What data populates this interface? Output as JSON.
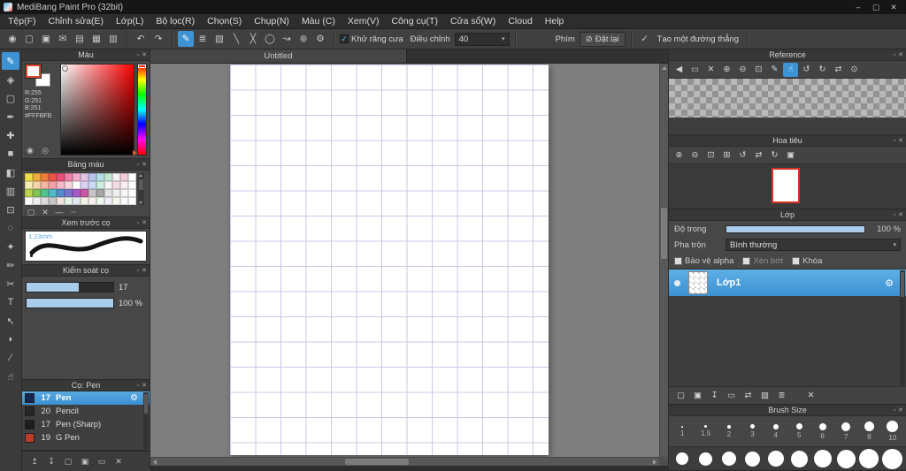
{
  "window": {
    "title": "MediBang Paint Pro (32bit)",
    "minimize": "–",
    "maximize": "▢",
    "close": "✕"
  },
  "ui": {
    "float_icon": "▫",
    "close_icon": "✕",
    "gear_icon": "⚙",
    "dropdown_arrow": "▾"
  },
  "menu": {
    "items": [
      "Tệp(F)",
      "Chỉnh sửa(E)",
      "Lớp(L)",
      "Bộ lọc(R)",
      "Chọn(S)",
      "Chụp(N)",
      "Màu (C)",
      "Xem(V)",
      "Công cụ(T)",
      "Cửa sổ(W)",
      "Cloud",
      "Help"
    ]
  },
  "toolbar": {
    "file_icons": [
      {
        "name": "logo-icon",
        "glyph": "◉"
      },
      {
        "name": "new-canvas-icon",
        "glyph": "▢"
      },
      {
        "name": "save-icon",
        "glyph": "▣"
      },
      {
        "name": "comment-icon",
        "glyph": "✉"
      },
      {
        "name": "export-icon",
        "glyph": "▤"
      },
      {
        "name": "grid-view-icon",
        "glyph": "▦"
      },
      {
        "name": "material-panel-icon",
        "glyph": "▥"
      }
    ],
    "undo_icon": "↶",
    "redo_icon": "↷",
    "brush_modes": [
      {
        "name": "freehand-mode-icon",
        "glyph": "✎",
        "selected": true
      },
      {
        "name": "multi-line-mode-icon",
        "glyph": "≣"
      },
      {
        "name": "hatch-mode-icon",
        "glyph": "▨"
      },
      {
        "name": "line-mode-icon",
        "glyph": "╲"
      },
      {
        "name": "cross-mode-icon",
        "glyph": "╳"
      },
      {
        "name": "ellipse-mode-icon",
        "glyph": "◯"
      },
      {
        "name": "curve-mode-icon",
        "glyph": "↝"
      },
      {
        "name": "scatter-mode-icon",
        "glyph": "⊛"
      },
      {
        "name": "brush-settings-icon",
        "glyph": "⚙"
      }
    ],
    "antialias_label": "Khử răng cưa",
    "correction_label": "Điều chỉnh",
    "correction_value": "40",
    "key_label": "Phím",
    "no_key_icon": "⊘",
    "reset_label": "Đặt lại",
    "check_icon": "✓",
    "straight_line_label": "Tạo một đường thẳng"
  },
  "tools": [
    {
      "name": "brush-tool",
      "glyph": "✎",
      "selected": true
    },
    {
      "name": "eraser-tool",
      "glyph": "◈"
    },
    {
      "name": "shape-tool",
      "glyph": "▢"
    },
    {
      "name": "ink-tool",
      "glyph": "✒"
    },
    {
      "name": "move-tool",
      "glyph": "✚"
    },
    {
      "name": "fill-tool",
      "glyph": "■"
    },
    {
      "name": "bucket-tool",
      "glyph": "◧"
    },
    {
      "name": "gradient-tool",
      "glyph": "▥"
    },
    {
      "name": "select-tool",
      "glyph": "⊡"
    },
    {
      "name": "lasso-tool",
      "glyph": "◌"
    },
    {
      "name": "magic-wand-tool",
      "glyph": "✦"
    },
    {
      "name": "select-pen-tool",
      "glyph": "✏"
    },
    {
      "name": "select-eraser-tool",
      "glyph": "✂"
    },
    {
      "name": "text-tool",
      "glyph": "T"
    },
    {
      "name": "operation-tool",
      "glyph": "↖"
    },
    {
      "name": "eyedropper-tool",
      "glyph": "◗"
    },
    {
      "name": "divide-tool",
      "glyph": "∕"
    },
    {
      "name": "hand-tool",
      "glyph": "☝"
    }
  ],
  "color_panel": {
    "title": "Màu",
    "r": "R:255",
    "g": "G:251",
    "b": "B:251",
    "hex": "#FFFBFB",
    "fg_color": "#FFFBFB",
    "icons": [
      {
        "name": "color-dialog-icon",
        "glyph": "◉"
      },
      {
        "name": "transparent-color-icon",
        "glyph": "◎"
      }
    ]
  },
  "palette_panel": {
    "title": "Bảng màu",
    "rows": [
      [
        "#efe04a",
        "#efab3e",
        "#ee7f3a",
        "#ec5546",
        "#ea4f78",
        "#ef82ac",
        "#f2abc9",
        "#e5c6e2",
        "#b7c3ea",
        "#b7dfea",
        "#c2ead2",
        "#f2f2f2",
        "#f2ccd8",
        "#ffffff"
      ],
      [
        "#f6eeb0",
        "#f6d5a6",
        "#f6b7a2",
        "#f4a2aa",
        "#f6bac9",
        "#f9d3dd",
        "#fefefe",
        "#dcd2f1",
        "#cadbf3",
        "#ccefde",
        "#f6f6f6",
        "#f6dde5",
        "#fbedf1",
        "#ffffff"
      ],
      [
        "#bbd34d",
        "#82c353",
        "#53c38d",
        "#51bbc3",
        "#538fcb",
        "#7973cb",
        "#a75bc7",
        "#cb57a7",
        "#c7c7c7",
        "#a7a7a7",
        "#e3e3e3",
        "#efefef",
        "#f6f6f6",
        "#ffffff"
      ],
      [
        "#ffffff",
        "#eeeeee",
        "#dbdbdb",
        "#c7c7c7",
        "#f3e3e3",
        "#e3f3e7",
        "#e3e7f3",
        "#f3f3e3",
        "#f9efef",
        "#eff9ef",
        "#efeff9",
        "#f9f9ef",
        "#fbfbfb",
        "#ffffff"
      ]
    ],
    "footer_icons": [
      {
        "name": "add-swatch-icon",
        "glyph": "▢"
      },
      {
        "name": "delete-swatch-icon",
        "glyph": "✕"
      },
      {
        "name": "solid-line-icon",
        "glyph": "—"
      },
      {
        "name": "dashed-line-icon",
        "glyph": "┄"
      }
    ]
  },
  "brush_preview_panel": {
    "title": "Xem trước cọ",
    "size_label": "1.23mm"
  },
  "brush_control_panel": {
    "title": "Kiểm soát cọ",
    "size_value": "17",
    "size_fill_pct": 60,
    "opacity_value": "100 %",
    "opacity_fill_pct": 100
  },
  "brush_list_panel": {
    "title": "Cọ: Pen",
    "items": [
      {
        "width": "17",
        "name": "Pen",
        "selected": true,
        "thumb": "#16264e"
      },
      {
        "width": "20",
        "name": "Pencil",
        "selected": false,
        "thumb": "#262626"
      },
      {
        "width": "17",
        "name": "Pen (Sharp)",
        "selected": false,
        "thumb": "#1d1d1d"
      },
      {
        "width": "19",
        "name": "G Pen",
        "selected": false,
        "thumb": "#c03a2b"
      }
    ]
  },
  "left_footer_icons": [
    {
      "name": "upload-brush-icon",
      "glyph": "↥"
    },
    {
      "name": "download-brush-icon",
      "glyph": "↧"
    },
    {
      "name": "add-brush-icon",
      "glyph": "▢"
    },
    {
      "name": "duplicate-brush-icon",
      "glyph": "▣"
    },
    {
      "name": "brush-folder-icon",
      "glyph": "▭"
    },
    {
      "name": "delete-brush-icon",
      "glyph": "✕"
    }
  ],
  "canvas": {
    "tab": "Untitled"
  },
  "reference_panel": {
    "title": "Reference",
    "toolbar": [
      {
        "name": "prev-image-icon",
        "glyph": "◀"
      },
      {
        "name": "open-image-icon",
        "glyph": "▭"
      },
      {
        "name": "close-image-icon",
        "glyph": "✕"
      },
      {
        "name": "zoom-in-icon",
        "glyph": "⊕"
      },
      {
        "name": "zoom-out-icon",
        "glyph": "⊖"
      },
      {
        "name": "zoom-fit-icon",
        "glyph": "⊡"
      },
      {
        "name": "eyedropper-icon",
        "glyph": "✎"
      },
      {
        "name": "hand-icon",
        "glyph": "☝",
        "selected": true
      },
      {
        "name": "rotate-ccw-icon",
        "glyph": "↺"
      },
      {
        "name": "rotate-cw-icon",
        "glyph": "↻"
      },
      {
        "name": "flip-horizontal-icon",
        "glyph": "⇄"
      },
      {
        "name": "reset-view-icon",
        "glyph": "⊙"
      }
    ]
  },
  "navigator_panel": {
    "title": "Hoa tiêu",
    "toolbar": [
      {
        "name": "zoom-in-icon",
        "glyph": "⊕"
      },
      {
        "name": "zoom-out-icon",
        "glyph": "⊖"
      },
      {
        "name": "zoom-fit-icon",
        "glyph": "⊡"
      },
      {
        "name": "zoom-100-icon",
        "glyph": "⊞"
      },
      {
        "name": "rotate-ccw-icon",
        "glyph": "↺"
      },
      {
        "name": "flip-horizontal-icon",
        "glyph": "⇄"
      },
      {
        "name": "rotate-cw-icon",
        "glyph": "↻"
      },
      {
        "name": "reset-rotation-icon",
        "glyph": "▣"
      }
    ]
  },
  "layers_panel": {
    "title": "Lớp",
    "opacity_label": "Độ trong",
    "opacity_value": "100 %",
    "blend_label": "Pha trộn",
    "blend_value": "Bình thường",
    "protect_alpha_label": "Bảo vệ alpha",
    "clipping_label": "Xén bớt",
    "lock_label": "Khóa",
    "layers": [
      {
        "name": "Lớp1",
        "selected": true
      }
    ],
    "footer_icons": [
      {
        "name": "new-layer-icon",
        "glyph": "▢"
      },
      {
        "name": "duplicate-layer-icon",
        "glyph": "▣"
      },
      {
        "name": "merge-down-icon",
        "glyph": "↧"
      },
      {
        "name": "new-folder-icon",
        "glyph": "▭"
      },
      {
        "name": "layer-order-icon",
        "glyph": "⇄"
      },
      {
        "name": "layer-color-icon",
        "glyph": "▧"
      },
      {
        "name": "layer-menu-icon",
        "glyph": "≣"
      },
      {
        "name": "delete-layer-icon",
        "glyph": "✕",
        "gap": true
      }
    ]
  },
  "brush_size_panel": {
    "title": "Brush Size",
    "row1": [
      {
        "label": "1",
        "d": 2
      },
      {
        "label": "1.5",
        "d": 3
      },
      {
        "label": "2",
        "d": 4
      },
      {
        "label": "3",
        "d": 5
      },
      {
        "label": "4",
        "d": 6
      },
      {
        "label": "5",
        "d": 7
      },
      {
        "label": "6",
        "d": 8
      },
      {
        "label": "7",
        "d": 10
      },
      {
        "label": "8",
        "d": 11
      },
      {
        "label": "10",
        "d": 13
      }
    ],
    "row2_diameters": [
      14,
      15,
      16,
      17,
      18,
      19,
      20,
      21,
      22,
      23
    ]
  },
  "colors": {
    "accent": "#3d93d4",
    "slider_fill": "#a9cdea",
    "selected_layer": "#4aa0d8",
    "navigator_border": "#d93025",
    "grid_line": "#c9c9e6",
    "foreground_color": "#FFFBFB"
  }
}
